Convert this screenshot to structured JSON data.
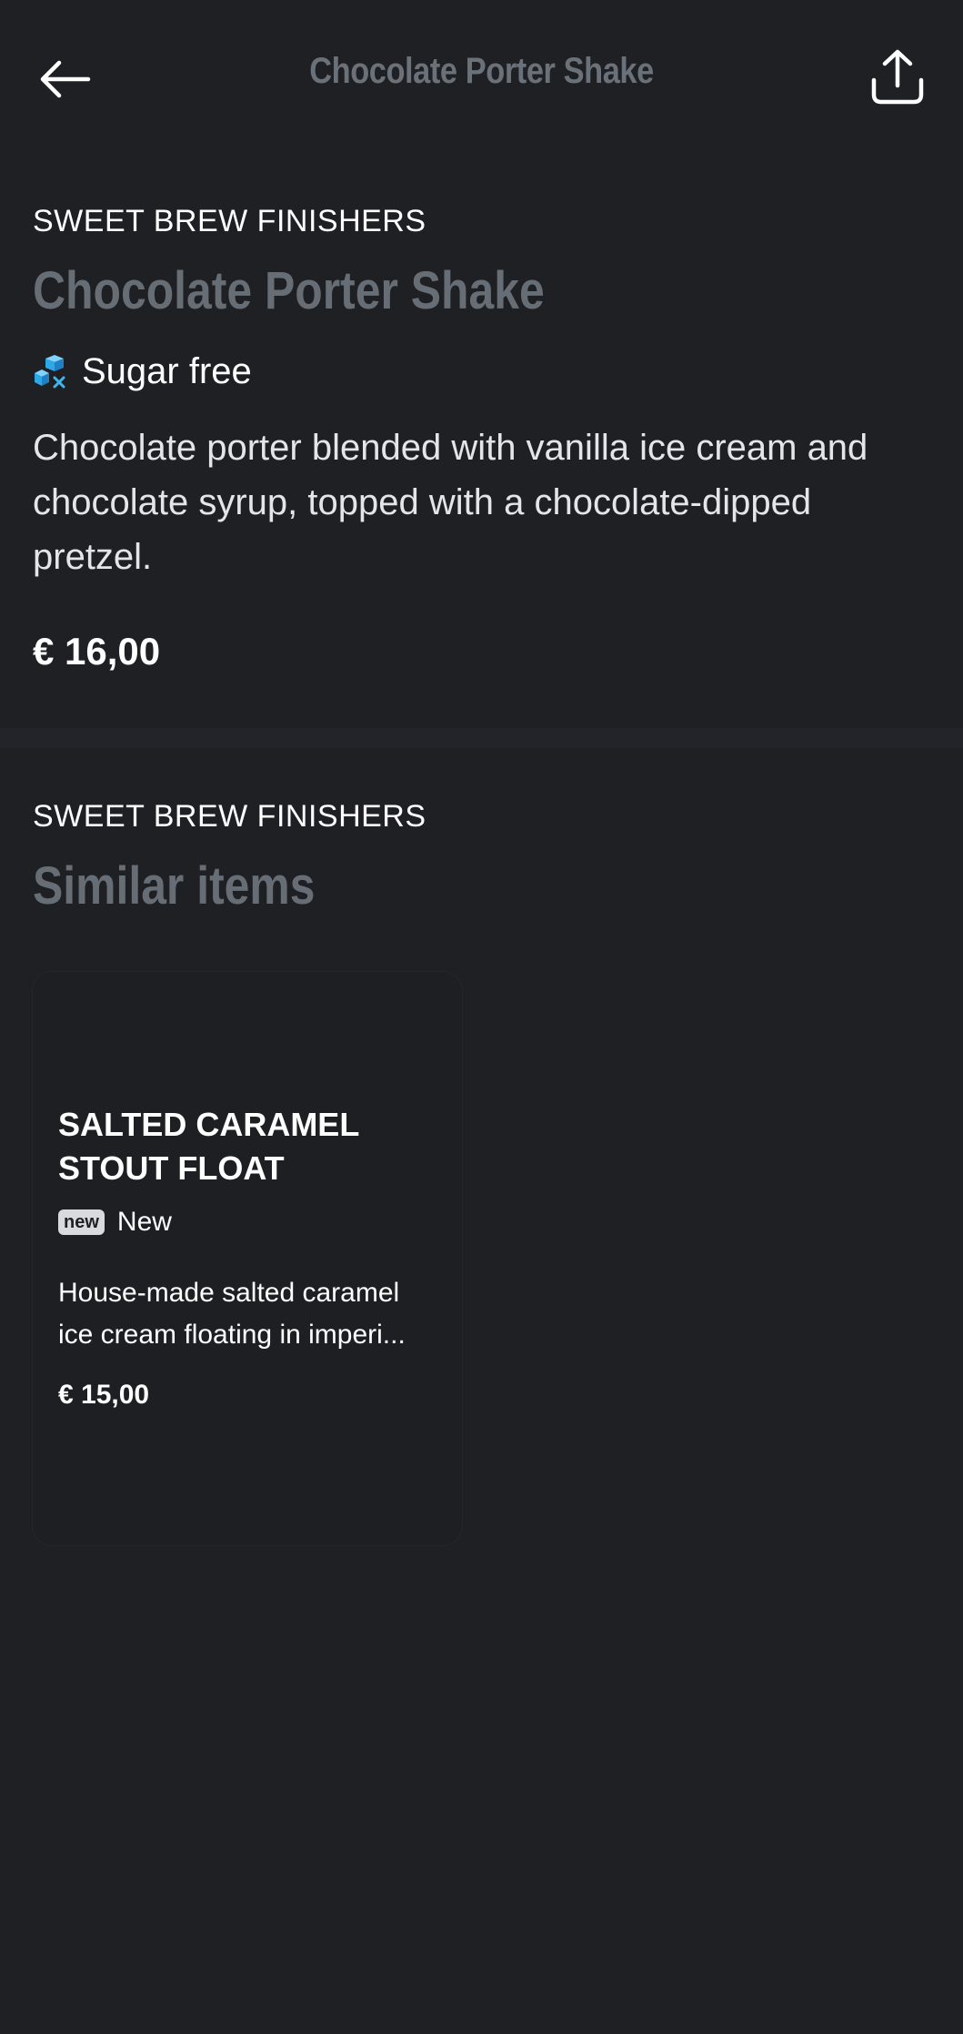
{
  "header": {
    "title": "Chocolate Porter Shake",
    "back_icon": "arrow-left-icon",
    "share_icon": "share-icon"
  },
  "item": {
    "category": "SWEET BREW FINISHERS",
    "name": "Chocolate Porter Shake",
    "tag_icon": "sugar-free-icon",
    "tag_label": "Sugar free",
    "description": "Chocolate porter blended with vanilla ice cream and chocolate syrup, topped with a chocolate-dipped pretzel.",
    "price": "€ 16,00"
  },
  "similar": {
    "category": "SWEET BREW FINISHERS",
    "heading": "Similar items",
    "items": [
      {
        "name": "Salted Caramel Stout Float",
        "badge": "new",
        "tag_label": "New",
        "description_line1": "House-made salted caramel",
        "description_line2": "ice cream floating in imperi...",
        "price": "€ 15,00"
      }
    ]
  },
  "colors": {
    "background": "#1f2024",
    "muted_heading": "#666d75",
    "accent_icon": "#3fb6f0"
  }
}
